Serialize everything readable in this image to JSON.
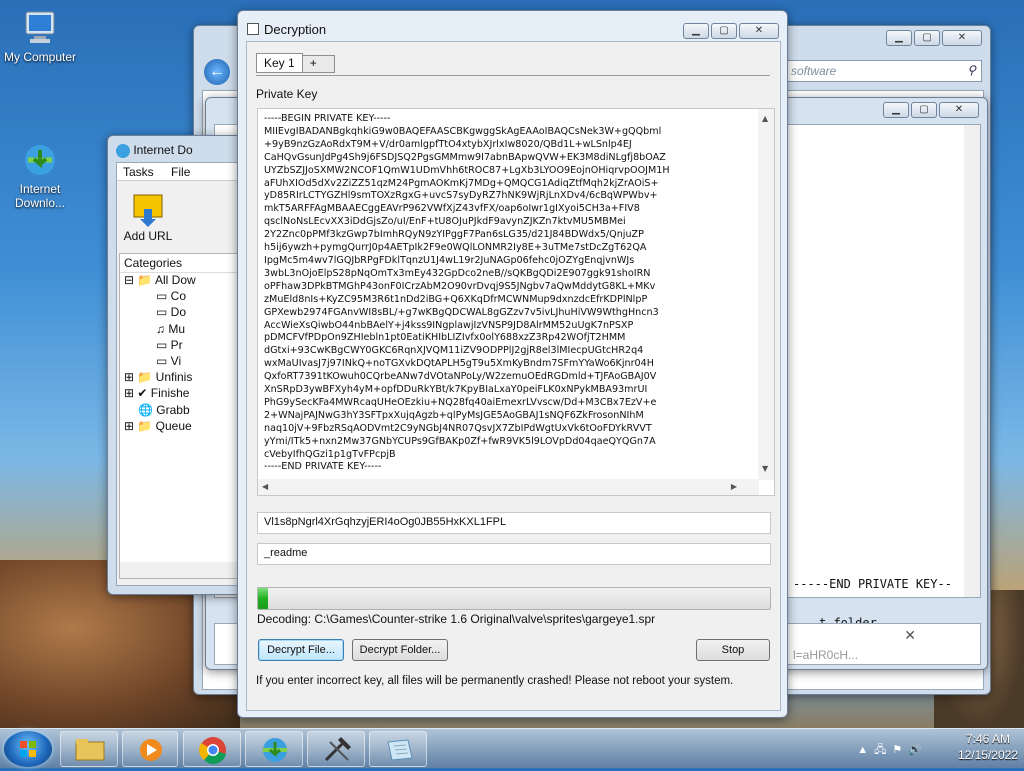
{
  "desktop": {
    "icons": [
      {
        "label": "My Computer"
      },
      {
        "label": "Internet\nDownlo..."
      }
    ]
  },
  "explorer": {
    "search_placeholder": "software"
  },
  "idm": {
    "title": "Internet Do",
    "menu": [
      "Tasks",
      "File"
    ],
    "add_url": "Add URL",
    "categories_title": "Categories",
    "tree": [
      "All Dow",
      "Co",
      "Do",
      "Mu",
      "Pr",
      "Vi",
      "Unfinis",
      "Finishe",
      "Grabb",
      "Queue"
    ]
  },
  "back_window": {
    "text_lines": [
      "-----END PRIVATE KEY--",
      "t folder."
    ],
    "url_fragment": "l=aHR0cH..."
  },
  "dialog": {
    "title": "Decryption",
    "tabs": [
      "Key 1",
      "+"
    ],
    "private_key_label": "Private Key",
    "private_key_lines": [
      "-----BEGIN PRIVATE KEY-----",
      "MIIEvgIBADANBgkqhkiG9w0BAQEFAASCBKgwggSkAgEAAoIBAQCsNek3W+gQQbml",
      "+9yB9nzGzAoRdxT9M+V/dr0amlgpfTtO4xtybXJrlxIw8020/QBd1L+wLSnlp4EJ",
      "CaHQvGsunJdPg4Sh9j6FSDJSQ2PgsGMMmw9I7abnBApwQVW+EK3M8diNLgfj8bOAZ",
      "UYZbSZJJoSXMW2NCOF1QmW1UDmVhh6tROC87+LgXb3LYOO9EojnOHiqrvpOOJM1H",
      "aFUhXIOd5dXv2ZiZZ51qzM24PgmAOKmKj7MDg+QMQCG1AdiqZtfMqh2kjZrAOiS+",
      "yD85RIrLCTYGZHl9smTOXzRgxG+uvcS7syDyRZ7hNK9WjRjLnXDv4/6cBqWPWbv+",
      "mkT5ARFFAgMBAAECggEAVrP962VWfXjZ43vfFX/oap6oIwr1gIXyoi5CH3a+FIV8",
      "qsclNoNsLEcvXX3iDdGjsZo/uI/EnF+tU8OJuPJkdF9avynZJKZn7ktvMU5MBMei",
      "2Y2Znc0pPMf3kzGwp7bImhRQyN9zYIPggF7Pan6sLG35/d21J84BDWdx5/QnjuZP",
      "h5ij6ywzh+pymgQurrJ0p4AETpIk2F9e0WQlLONMR2Iy8E+3uTMe7stDcZgT62QA",
      "IpgMc5m4wv7lGQJbRPgFDklTqnzU1J4wL19r2JuNAGp06fehc0jOZYgEnqjvnWJs",
      "3wbL3nOjoElpS28pNqOmTx3mEy432GpDco2neB//sQKBgQDi2E907ggk91shoIRN",
      "oPFhaw3DPkBTMGhP43onF0ICrzAbM2O90vrDvqj9S5JNgbv7aQwMddytG8KL+MKv",
      "zMuEld8nIs+KyZC95M3R6t1nDd2iBG+Q6XKqDfrMCWNMup9dxnzdcEfrKDPlNlpP",
      "GPXewb2974FGAnvWI8sBL/+g7wKBgQDCWAL8gGZzv7v5ivLJhuHiVW9WthgHncn3",
      "AccWieXsQiwbO44nbBAelY+j4kss9INgplawjIzVNSP9JD8AlrMM52uUgK7nPSXP",
      "pDMCFVfPDpOn9ZHIebln1pt0EatiKHIbLIZIvfx0olY688xzZ3Rp42WOfjT2HMM",
      "dGtxi+93CwKBgCWY0GKC6RqnXJVQM11iZV9ODPPlJ2gjR8el3lMIecpUGtcHR2q4",
      "wxMaUIvasJ7j97INkQ+noTGXvkDQtAPLH5gT9u5XmKyBndm7SFmYYaWo6Kjnr04H",
      "QxfoRT7391tKOwuh0CQrbeANw7dVOtaNPoLy/W2zemuOEdRGDmld+TJFAoGBAJ0V",
      "XnSRpD3ywBFXyh4yM+opfDDuRkYBt/k7KpyBIaLxaY0peiFLK0xNPykMBA93mrUI",
      "PhG9ySecKFa4MWRcaqUHeOEzkiu+NQ28fq40aiEmexrLVvscw/Dd+M3CBx7EzV+e",
      "2+WNajPAJNwG3hY3SFTpxXujqAgzb+qlPyMsJGE5AoGBAJ1sNQF6ZkFrosonNIhM",
      "naq10jV+9FbzRSqAODVmt2C9yNGbJ4NR07QsvJX7ZbIPdWgtUxVk6tOoFDYkRVVT",
      "yYmi/ITk5+nxn2Mw37GNbYCUPs9GfBAKp0Zf+fwR9VK5l9LOVpDd04qaeQYQGn7A",
      "cVebyIfhQGzi1p1gTvFPcpjB",
      "-----END PRIVATE KEY-----"
    ],
    "key_id": "Vl1s8pNgrl4XrGqhzyjERI4oOg0JB55HxKXL1FPL",
    "extension": "_readme",
    "progress_fraction": 0.02,
    "decoding_status": "Decoding: C:\\Games\\Counter-strike 1.6 Original\\valve\\sprites\\gargeye1.spr",
    "decrypt_file_label": "Decrypt File...",
    "decrypt_folder_label": "Decrypt Folder...",
    "stop_label": "Stop",
    "warning": "If you enter incorrect key, all files will be permanently crashed! Please not reboot your system."
  },
  "taskbar": {
    "time": "7:46 AM",
    "date": "12/15/2022"
  }
}
